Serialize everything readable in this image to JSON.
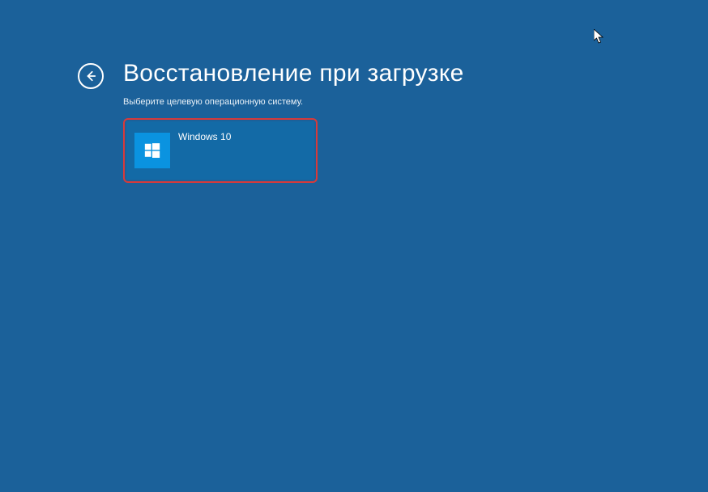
{
  "header": {
    "title": "Восстановление при загрузке",
    "subtitle": "Выберите целевую операционную систему."
  },
  "os_options": [
    {
      "label": "Windows 10",
      "icon": "windows-logo-icon"
    }
  ]
}
